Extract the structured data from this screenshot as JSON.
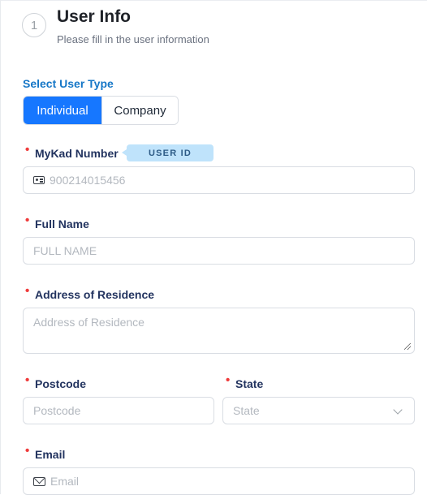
{
  "header": {
    "step_number": "1",
    "title": "User Info",
    "subtitle": "Please fill in the user information"
  },
  "user_type": {
    "label": "Select User Type",
    "options": [
      "Individual",
      "Company"
    ],
    "selected": "Individual"
  },
  "mykad": {
    "label": "MyKad Number",
    "tag": "USER ID",
    "placeholder": "900214015456",
    "icon": "id-card-icon"
  },
  "full_name": {
    "label": "Full Name",
    "placeholder": "FULL NAME"
  },
  "address": {
    "label": "Address of Residence",
    "placeholder": "Address of Residence"
  },
  "postcode": {
    "label": "Postcode",
    "placeholder": "Postcode"
  },
  "state": {
    "label": "State",
    "placeholder": "State",
    "icon": "chevron-down-icon"
  },
  "email": {
    "label": "Email",
    "placeholder": "Email",
    "icon": "mail-icon"
  },
  "colors": {
    "primary": "#1677ff",
    "required": "#ef3b3b",
    "tag_bg": "#bfe3fb",
    "label": "#22335f"
  }
}
